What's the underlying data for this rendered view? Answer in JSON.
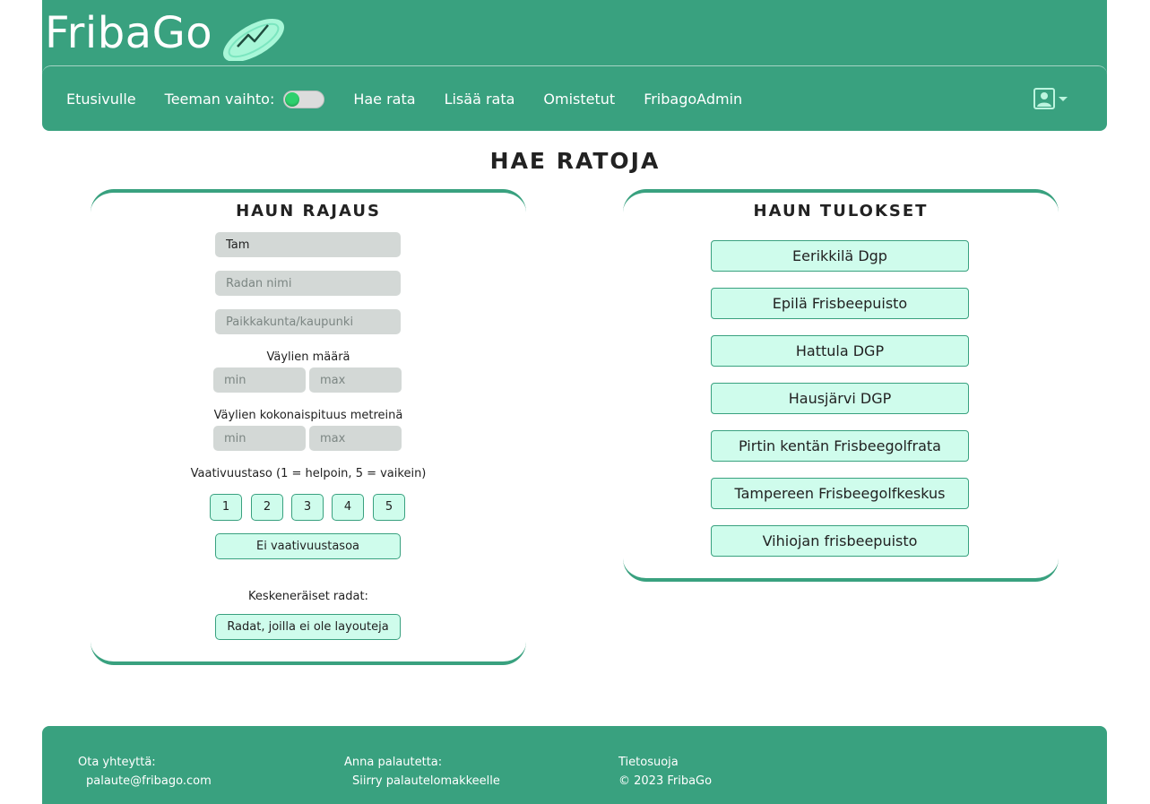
{
  "brand": {
    "name": "FribaGo",
    "logo_icon": "frisbee-disc-icon",
    "color": "#39a17f",
    "accent": "#cffcec"
  },
  "nav": {
    "home": "Etusivulle",
    "theme_label": "Teeman vaihto:",
    "search": "Hae rata",
    "add": "Lisää rata",
    "owned": "Omistetut",
    "admin": "FribagoAdmin",
    "user_icon": "user-profile-icon"
  },
  "page_title": "HAE RATOJA",
  "filters": {
    "title": "HAUN RAJAUS",
    "search_value": "Tam",
    "course_name_placeholder": "Radan nimi",
    "city_placeholder": "Paikkakunta/kaupunki",
    "holes_label": "Väylien määrä",
    "length_label": "Väylien kokonaispituus metreinä",
    "min_placeholder": "min",
    "max_placeholder": "max",
    "difficulty_label": "Vaativuustaso (1 = helpoin, 5 = vaikein)",
    "levels": [
      "1",
      "2",
      "3",
      "4",
      "5"
    ],
    "no_level": "Ei vaativuustasoa",
    "unfinished_label": "Keskeneräiset radat:",
    "no_layouts": "Radat, joilla ei ole layouteja"
  },
  "results": {
    "title": "HAUN TULOKSET",
    "items": [
      "Eerikkilä Dgp",
      "Epilä Frisbeepuisto",
      "Hattula DGP",
      "Hausjärvi DGP",
      "Pirtin kentän Frisbeegolfrata",
      "Tampereen Frisbeegolfkeskus",
      "Vihiojan frisbeepuisto"
    ]
  },
  "footer": {
    "contact_label": "Ota yhteyttä:",
    "contact_email": "palaute@fribago.com",
    "feedback_label": "Anna palautetta:",
    "feedback_link": "Siirry palautelomakkeelle",
    "privacy": "Tietosuoja",
    "copyright": "© 2023 FribaGo"
  }
}
